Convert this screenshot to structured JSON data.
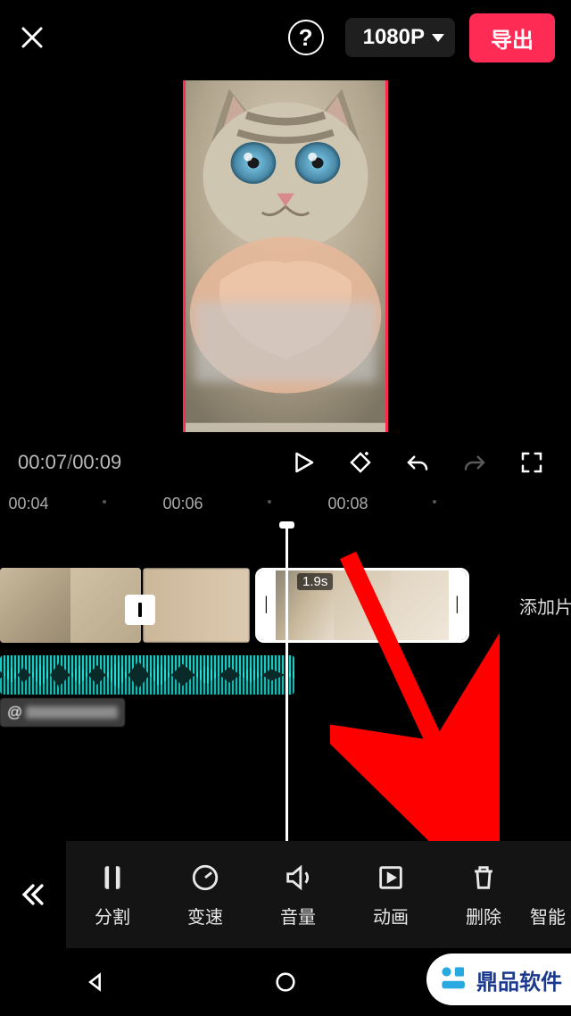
{
  "header": {
    "resolution": "1080P",
    "export_label": "导出",
    "help_glyph": "?"
  },
  "playbar": {
    "current_time": "00:07",
    "total_time": "00:09"
  },
  "ruler": {
    "ticks": [
      "00:04",
      "00:06",
      "00:08"
    ]
  },
  "timeline": {
    "selected_clip_duration": "1.9s",
    "add_clip_label": "添加片",
    "author_prefix": "@"
  },
  "toolbar": {
    "items": [
      {
        "id": "split",
        "label": "分割"
      },
      {
        "id": "speed",
        "label": "变速"
      },
      {
        "id": "volume",
        "label": "音量"
      },
      {
        "id": "animation",
        "label": "动画"
      },
      {
        "id": "delete",
        "label": "删除"
      },
      {
        "id": "smart",
        "label": "智能"
      }
    ]
  },
  "watermark": {
    "text": "鼎品软件"
  },
  "colors": {
    "accent": "#fe2c55",
    "audio": "#17d1c7"
  }
}
